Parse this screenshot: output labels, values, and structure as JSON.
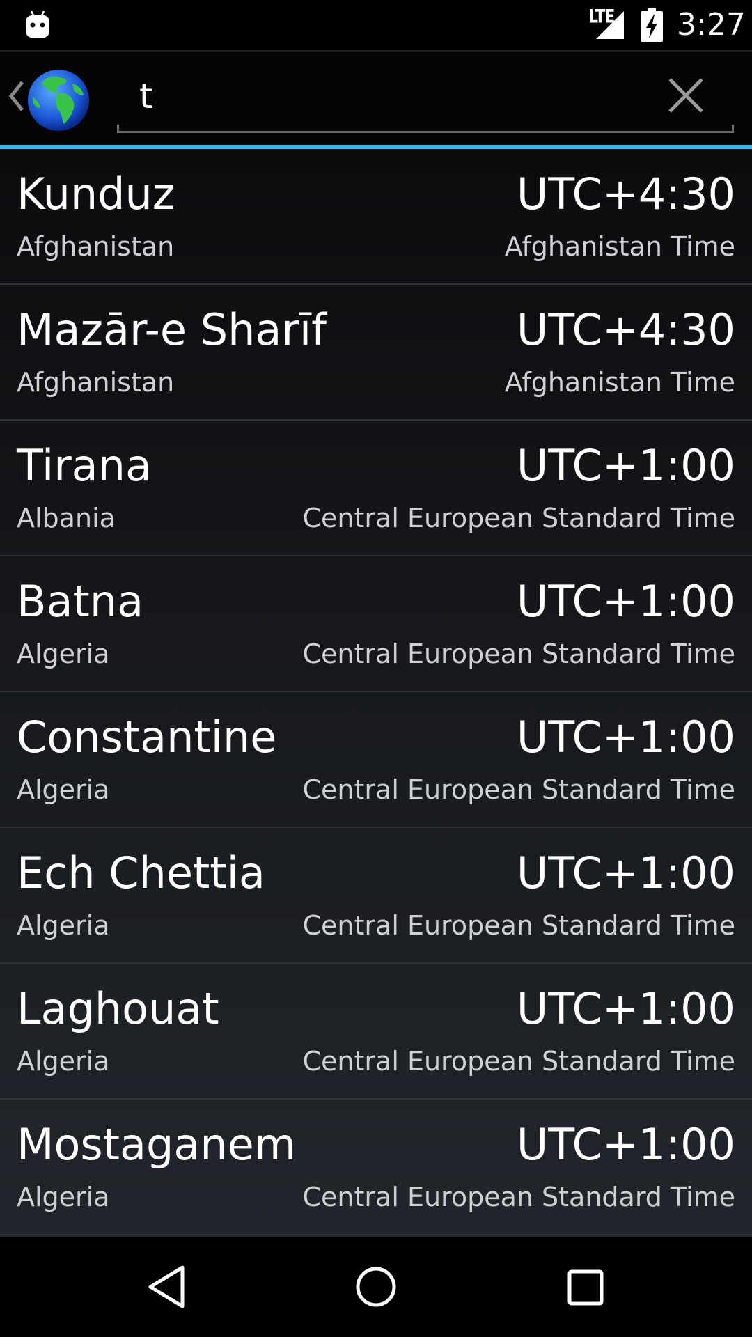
{
  "status_bar": {
    "network": "LTE",
    "time": "3:27",
    "icons": [
      "android-notification-icon",
      "signal-icon",
      "battery-charging-icon"
    ]
  },
  "action_bar": {
    "search_value": "t",
    "icons": [
      "back-caret-icon",
      "globe-icon",
      "close-icon"
    ]
  },
  "colors": {
    "accent": "#33b5e5",
    "background": "#000000",
    "divider": "#2e3136"
  },
  "results": [
    {
      "city": "Kunduz",
      "country": "Afghanistan",
      "offset": "UTC+4:30",
      "timezone": "Afghanistan Time"
    },
    {
      "city": "Mazār-e Sharīf",
      "country": "Afghanistan",
      "offset": "UTC+4:30",
      "timezone": "Afghanistan Time"
    },
    {
      "city": "Tirana",
      "country": "Albania",
      "offset": "UTC+1:00",
      "timezone": "Central European Standard Time"
    },
    {
      "city": "Batna",
      "country": "Algeria",
      "offset": "UTC+1:00",
      "timezone": "Central European Standard Time"
    },
    {
      "city": "Constantine",
      "country": "Algeria",
      "offset": "UTC+1:00",
      "timezone": "Central European Standard Time"
    },
    {
      "city": "Ech Chettia",
      "country": "Algeria",
      "offset": "UTC+1:00",
      "timezone": "Central European Standard Time"
    },
    {
      "city": "Laghouat",
      "country": "Algeria",
      "offset": "UTC+1:00",
      "timezone": "Central European Standard Time"
    },
    {
      "city": "Mostaganem",
      "country": "Algeria",
      "offset": "UTC+1:00",
      "timezone": "Central European Standard Time"
    }
  ],
  "nav_bar": {
    "icons": [
      "nav-back-icon",
      "nav-home-icon",
      "nav-recents-icon"
    ]
  }
}
